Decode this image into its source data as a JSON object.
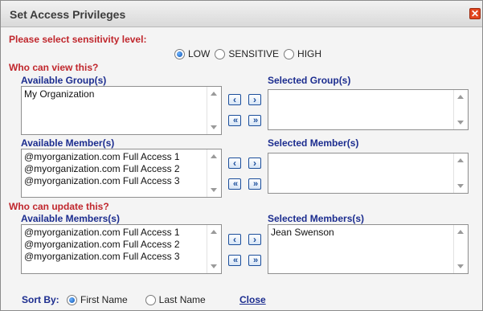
{
  "dialog": {
    "title": "Set Access Privileges",
    "close_glyph": "✕"
  },
  "sensitivity": {
    "prompt": "Please select sensitivity level:",
    "options": [
      "LOW",
      "SENSITIVE",
      "HIGH"
    ],
    "selected": "LOW"
  },
  "view": {
    "heading": "Who can view this?",
    "available_groups_label": "Available Group(s)",
    "selected_groups_label": "Selected Group(s)",
    "available_groups": [
      "My Organization"
    ],
    "selected_groups": [],
    "available_members_label": "Available Member(s)",
    "selected_members_label": "Selected Member(s)",
    "available_members": [
      "@myorganization.com Full Access 1",
      "@myorganization.com Full Access 2",
      "@myorganization.com Full Access 3"
    ],
    "selected_members": []
  },
  "update": {
    "heading": "Who can update this?",
    "available_members_label": "Available Members(s)",
    "selected_members_label": "Selected Members(s)",
    "available_members": [
      "@myorganization.com Full Access 1",
      "@myorganization.com Full Access 2",
      "@myorganization.com Full Access 3"
    ],
    "selected_members": [
      "Jean Swenson"
    ]
  },
  "buttons": {
    "move_one_left": "‹",
    "move_one_right": "›",
    "move_all_left": "«",
    "move_all_right": "»"
  },
  "footer": {
    "sort_by_label": "Sort By:",
    "sort_options": [
      "First Name",
      "Last Name"
    ],
    "sort_selected": "First Name",
    "close_link": "Close"
  }
}
